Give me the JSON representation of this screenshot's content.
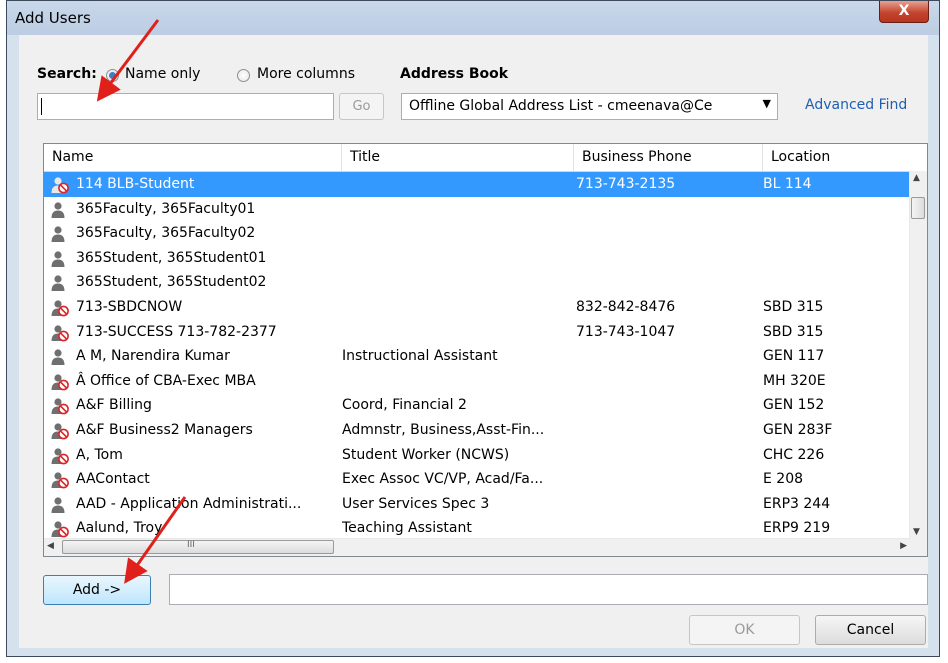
{
  "window": {
    "title": "Add Users",
    "close_glyph": "X"
  },
  "search": {
    "label": "Search:",
    "option_name_only": "Name only",
    "option_more_columns": "More columns",
    "selected": "Name only",
    "value": "",
    "go_label": "Go"
  },
  "address_book": {
    "label": "Address Book",
    "selected": "Offline Global Address List - cmeenava@Ce",
    "advanced_find": "Advanced Find"
  },
  "table": {
    "columns": [
      "Name",
      "Title",
      "Business Phone",
      "Location"
    ],
    "rows": [
      {
        "name": "114 BLB-Student",
        "title": "",
        "phone": "713-743-2135",
        "location": "BL 114",
        "icon": "blocked-user-icon",
        "selected": true
      },
      {
        "name": "365Faculty, 365Faculty01",
        "title": "",
        "phone": "",
        "location": "",
        "icon": "user-icon"
      },
      {
        "name": "365Faculty, 365Faculty02",
        "title": "",
        "phone": "",
        "location": "",
        "icon": "user-icon"
      },
      {
        "name": "365Student, 365Student01",
        "title": "",
        "phone": "",
        "location": "",
        "icon": "user-icon"
      },
      {
        "name": "365Student, 365Student02",
        "title": "",
        "phone": "",
        "location": "",
        "icon": "user-icon"
      },
      {
        "name": "713-SBDCNOW",
        "title": "",
        "phone": "832-842-8476",
        "location": "SBD 315",
        "icon": "blocked-user-icon"
      },
      {
        "name": "713-SUCCESS 713-782-2377",
        "title": "",
        "phone": "713-743-1047",
        "location": "SBD 315",
        "icon": "blocked-user-icon"
      },
      {
        "name": "A M, Narendira Kumar",
        "title": "Instructional Assistant",
        "phone": "",
        "location": "GEN 117",
        "icon": "user-icon"
      },
      {
        "name": "Â Office of CBA-Exec MBA",
        "title": "",
        "phone": "",
        "location": "MH 320E",
        "icon": "blocked-user-icon"
      },
      {
        "name": "A&F Billing",
        "title": "Coord, Financial 2",
        "phone": "",
        "location": "GEN 152",
        "icon": "blocked-user-icon"
      },
      {
        "name": "A&F Business2 Managers",
        "title": "Admnstr, Business,Asst-Fin...",
        "phone": "",
        "location": "GEN 283F",
        "icon": "blocked-user-icon"
      },
      {
        "name": "A, Tom",
        "title": "Student Worker (NCWS)",
        "phone": "",
        "location": "CHC 226",
        "icon": "blocked-user-icon"
      },
      {
        "name": "AAContact",
        "title": "Exec Assoc VC/VP, Acad/Fa...",
        "phone": "",
        "location": "E 208",
        "icon": "blocked-user-icon"
      },
      {
        "name": "AAD - Application Administrati...",
        "title": "User Services Spec 3",
        "phone": "",
        "location": "ERP3 244",
        "icon": "user-icon"
      },
      {
        "name": "Aalund, Troy",
        "title": "Teaching Assistant",
        "phone": "",
        "location": "ERP9 219",
        "icon": "blocked-user-icon"
      }
    ]
  },
  "scroll": {
    "up_glyph": "▲",
    "down_glyph": "▼",
    "left_glyph": "◀",
    "right_glyph": "▶",
    "grip_glyph": "III"
  },
  "actions": {
    "add_label": "Add ->",
    "add_value": "",
    "ok_label": "OK",
    "cancel_label": "Cancel"
  },
  "colors": {
    "selection": "#3399ff",
    "annotation_arrow": "#e0201b",
    "link": "#1e5fb3"
  }
}
